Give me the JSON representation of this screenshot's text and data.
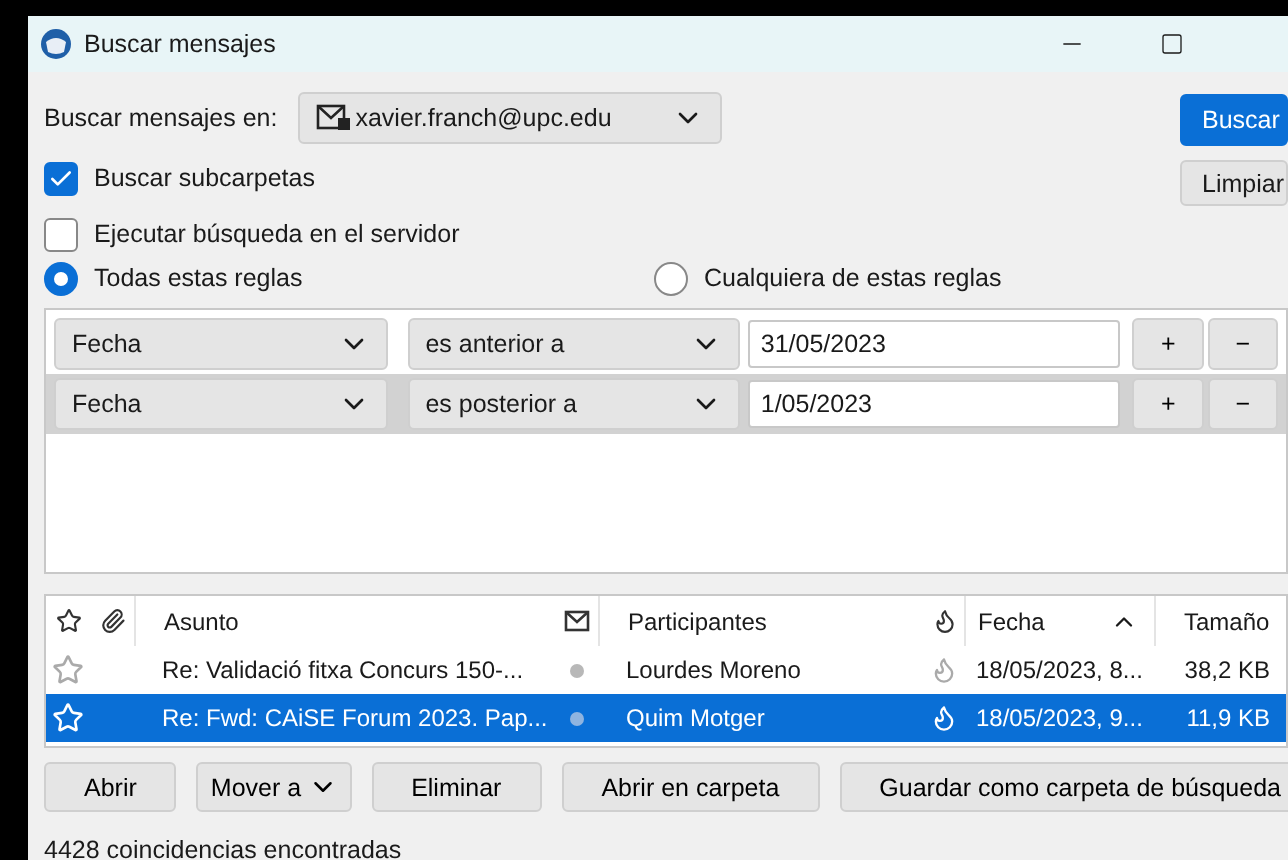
{
  "window": {
    "title": "Buscar mensajes"
  },
  "search_in": {
    "label": "Buscar mensajes en:",
    "account": "xavier.franch@upc.edu"
  },
  "side_buttons": [
    {
      "label": "Buscar",
      "kind": "primary"
    },
    {
      "label": "Limpiar",
      "kind": "plain"
    }
  ],
  "options": [
    {
      "label": "Buscar subcarpetas",
      "checked": true
    },
    {
      "label": "Ejecutar búsqueda en el servidor",
      "checked": false
    }
  ],
  "match": [
    {
      "label": "Todas estas reglas",
      "selected": true
    },
    {
      "label": "Cualquiera de estas reglas",
      "selected": false
    }
  ],
  "rules": [
    {
      "field": "Fecha",
      "operator": "es anterior a",
      "value": "31/05/2023",
      "add": "+",
      "remove": "−",
      "selected": false
    },
    {
      "field": "Fecha",
      "operator": "es posterior a",
      "value": "1/05/2023",
      "add": "+",
      "remove": "−",
      "selected": true
    }
  ],
  "table": {
    "columns": [
      {
        "kind": "star"
      },
      {
        "kind": "attachment"
      },
      {
        "kind": "text",
        "label": "Asunto",
        "sorted": false
      },
      {
        "kind": "read"
      },
      {
        "kind": "text",
        "label": "Participantes",
        "sorted": false
      },
      {
        "kind": "thread"
      },
      {
        "kind": "text",
        "label": "Fecha",
        "sorted": true
      },
      {
        "kind": "text",
        "label": "Tamaño",
        "sorted": false
      }
    ],
    "rows": [
      {
        "starred": false,
        "subject": "Re: Validació fitxa Concurs 150-...",
        "participants": "Lourdes Moreno",
        "date": "18/05/2023, 8...",
        "size": "38,2 KB",
        "selected": false
      },
      {
        "starred": false,
        "subject": "Re: Fwd: CAiSE Forum 2023. Pap...",
        "participants": "Quim Motger",
        "date": "18/05/2023, 9...",
        "size": "11,9 KB",
        "selected": true
      }
    ]
  },
  "buttons": [
    {
      "label": "Abrir",
      "kind": "plain"
    },
    {
      "label": "Mover a",
      "kind": "menu"
    },
    {
      "label": "Eliminar",
      "kind": "plain"
    },
    {
      "label": "Abrir en carpeta",
      "kind": "plain"
    },
    {
      "label": "Guardar como carpeta de búsqueda",
      "kind": "plain"
    }
  ],
  "status_bar": "4428 coincidencias encontradas"
}
